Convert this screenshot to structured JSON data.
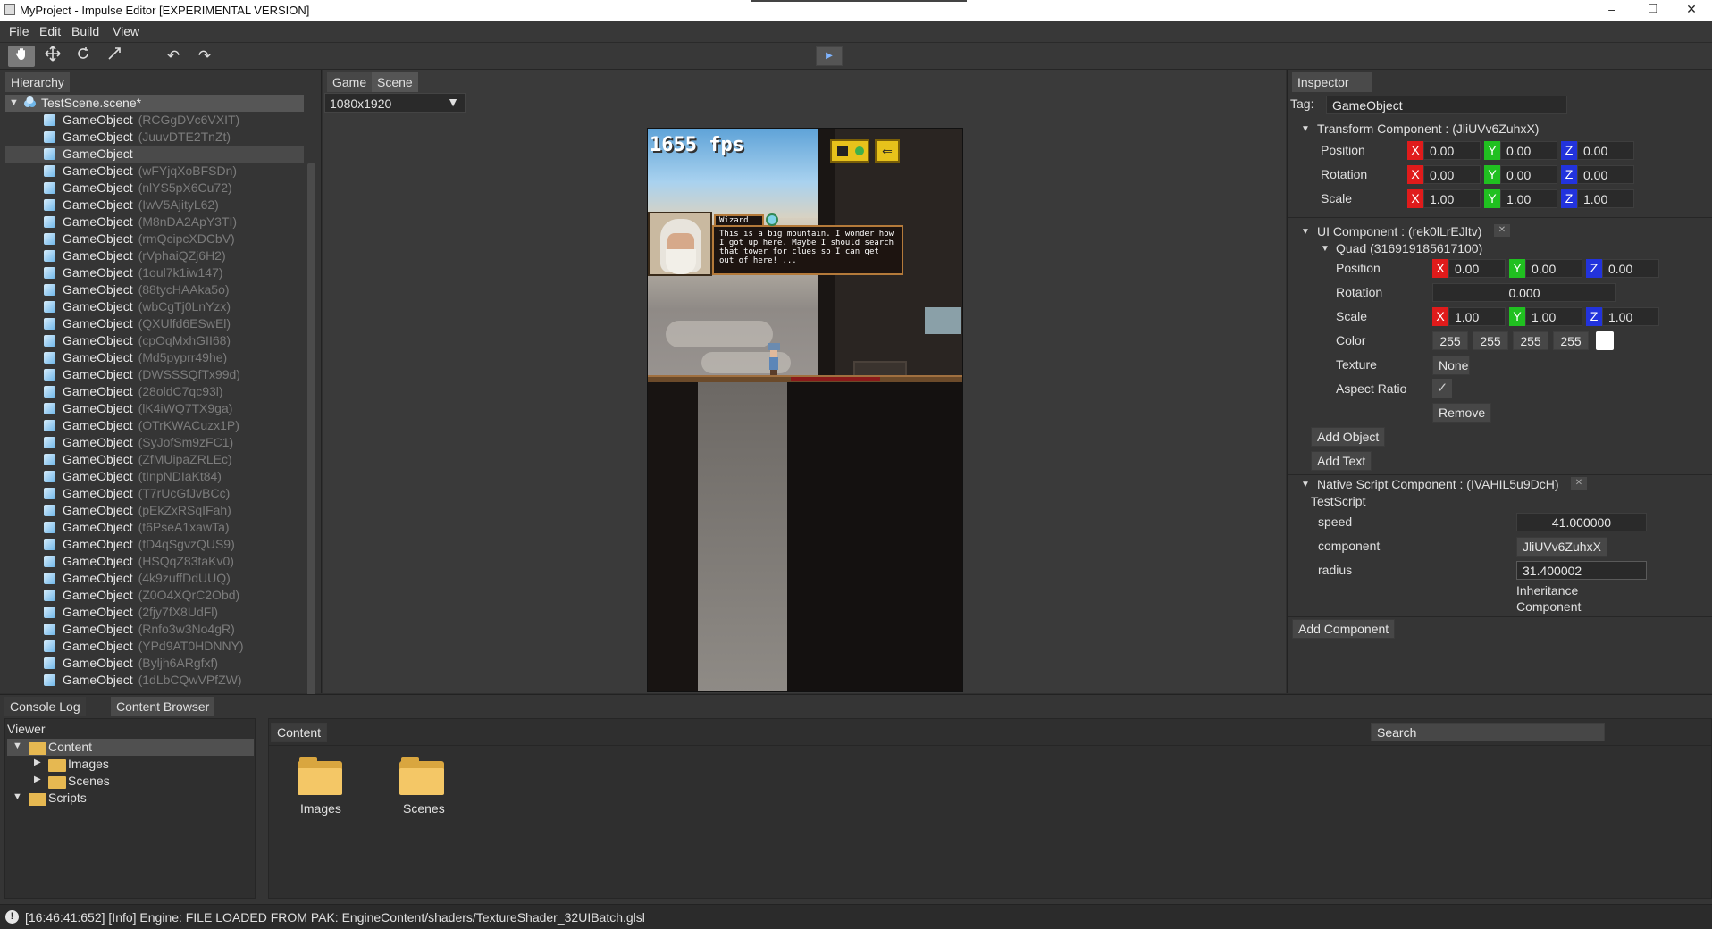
{
  "window": {
    "title": "MyProject - Impulse Editor [EXPERIMENTAL VERSION]",
    "minimize": "–",
    "maximize": "❐",
    "close": "✕"
  },
  "menu": [
    "File",
    "Edit",
    "Build",
    "View"
  ],
  "toolbar": {
    "tools": [
      "hand-tool",
      "move-tool",
      "rotate-tool",
      "scale-tool"
    ],
    "undo": "↶",
    "redo": "↷",
    "play": "▶"
  },
  "hierarchy": {
    "tab": "Hierarchy",
    "scene": "TestScene.scene*",
    "items": [
      {
        "name": "GameObject",
        "id": "(RCGgDVc6VXIT)"
      },
      {
        "name": "GameObject",
        "id": "(JuuvDTE2TnZt)"
      },
      {
        "name": "GameObject",
        "id": "",
        "selected": true
      },
      {
        "name": "GameObject",
        "id": "(wFYjqXoBFSDn)"
      },
      {
        "name": "GameObject",
        "id": "(nlYS5pX6Cu72)"
      },
      {
        "name": "GameObject",
        "id": "(IwV5AjityL62)"
      },
      {
        "name": "GameObject",
        "id": "(M8nDA2ApY3TI)"
      },
      {
        "name": "GameObject",
        "id": "(rmQcipcXDCbV)"
      },
      {
        "name": "GameObject",
        "id": "(rVphaiQZj6H2)"
      },
      {
        "name": "GameObject",
        "id": "(1oul7k1iw147)"
      },
      {
        "name": "GameObject",
        "id": "(88tycHAAka5o)"
      },
      {
        "name": "GameObject",
        "id": "(wbCgTj0LnYzx)"
      },
      {
        "name": "GameObject",
        "id": "(QXUlfd6ESwEl)"
      },
      {
        "name": "GameObject",
        "id": "(cpOqMxhGII68)"
      },
      {
        "name": "GameObject",
        "id": "(Md5pyprr49he)"
      },
      {
        "name": "GameObject",
        "id": "(DWSSSQfTx99d)"
      },
      {
        "name": "GameObject",
        "id": "(28oldC7qc93l)"
      },
      {
        "name": "GameObject",
        "id": "(lK4iWQ7TX9ga)"
      },
      {
        "name": "GameObject",
        "id": "(OTrKWACuzx1P)"
      },
      {
        "name": "GameObject",
        "id": "(SyJofSm9zFC1)"
      },
      {
        "name": "GameObject",
        "id": "(ZfMUipaZRLEc)"
      },
      {
        "name": "GameObject",
        "id": "(tInpNDIaKt84)"
      },
      {
        "name": "GameObject",
        "id": "(T7rUcGfJvBCc)"
      },
      {
        "name": "GameObject",
        "id": "(pEkZxRSqIFah)"
      },
      {
        "name": "GameObject",
        "id": "(t6PseA1xawTa)"
      },
      {
        "name": "GameObject",
        "id": "(fD4qSgvzQUS9)"
      },
      {
        "name": "GameObject",
        "id": "(HSQqZ83taKv0)"
      },
      {
        "name": "GameObject",
        "id": "(4k9zuffDdUUQ)"
      },
      {
        "name": "GameObject",
        "id": "(Z0O4XQrC2Obd)"
      },
      {
        "name": "GameObject",
        "id": "(2fjy7fX8UdFl)"
      },
      {
        "name": "GameObject",
        "id": "(Rnfo3w3No4gR)"
      },
      {
        "name": "GameObject",
        "id": "(YPd9AT0HDNNY)"
      },
      {
        "name": "GameObject",
        "id": "(Byljh6ARgfxf)"
      },
      {
        "name": "GameObject",
        "id": "(1dLbCQwVPfZW)"
      }
    ]
  },
  "scene_panel": {
    "tabs": [
      "Game",
      "Scene"
    ],
    "resolution": "1080x1920",
    "fps": "1655 fps",
    "dialog_name": "Wizard",
    "dialog_text": "This is a big mountain. I wonder how I got up here. Maybe I should search that tower for clues so I can get out of here! ..."
  },
  "inspector": {
    "tab": "Inspector",
    "tag_label": "Tag:",
    "tag_value": "GameObject",
    "transform": {
      "header": "Transform Component : (JliUVv6ZuhxX)",
      "position": {
        "label": "Position",
        "x": "0.00",
        "y": "0.00",
        "z": "0.00"
      },
      "rotation": {
        "label": "Rotation",
        "x": "0.00",
        "y": "0.00",
        "z": "0.00"
      },
      "scale": {
        "label": "Scale",
        "x": "1.00",
        "y": "1.00",
        "z": "1.00"
      }
    },
    "ui": {
      "header": "UI Component : (rek0lLrEJltv)",
      "quad": "Quad (316919185617100)",
      "position": {
        "label": "Position",
        "x": "0.00",
        "y": "0.00",
        "z": "0.00"
      },
      "rotation": {
        "label": "Rotation",
        "value": "0.000"
      },
      "scale": {
        "label": "Scale",
        "x": "1.00",
        "y": "1.00",
        "z": "1.00"
      },
      "color": {
        "label": "Color",
        "r": "255",
        "g": "255",
        "b": "255",
        "a": "255",
        "swatch": "#ffffff"
      },
      "texture": {
        "label": "Texture",
        "value": "None"
      },
      "aspect": {
        "label": "Aspect Ratio",
        "checked": "✓"
      },
      "remove": "Remove",
      "add_object": "Add Object",
      "add_text": "Add Text"
    },
    "script": {
      "header": "Native Script Component : (IVAHIL5u9DcH)",
      "name": "TestScript",
      "speed": {
        "label": "speed",
        "value": "41.000000"
      },
      "component": {
        "label": "component",
        "value": "JliUVv6ZuhxX"
      },
      "radius": {
        "label": "radius",
        "value": "31.400002"
      },
      "inherit": "Inheritance",
      "inherit2": "Component"
    },
    "add_component": "Add Component",
    "axis": {
      "x": "X",
      "y": "Y",
      "z": "Z"
    }
  },
  "bottom": {
    "tabs": [
      "Console Log",
      "Content Browser"
    ],
    "viewer": "Viewer",
    "tree": [
      {
        "label": "Content",
        "level": 0,
        "arrow": "▼"
      },
      {
        "label": "Images",
        "level": 1,
        "arrow": "▶"
      },
      {
        "label": "Scenes",
        "level": 1,
        "arrow": "▶"
      },
      {
        "label": "Scripts",
        "level": 0,
        "arrow": "▼"
      }
    ],
    "content_path": "Content",
    "search_placeholder": "Search",
    "folders": [
      "Images",
      "Scenes"
    ]
  },
  "status": {
    "icon": "info-icon",
    "message": "[16:46:41:652] [Info]  Engine: FILE LOADED FROM PAK: EngineContent/shaders/TextureShader_32UIBatch.glsl"
  }
}
